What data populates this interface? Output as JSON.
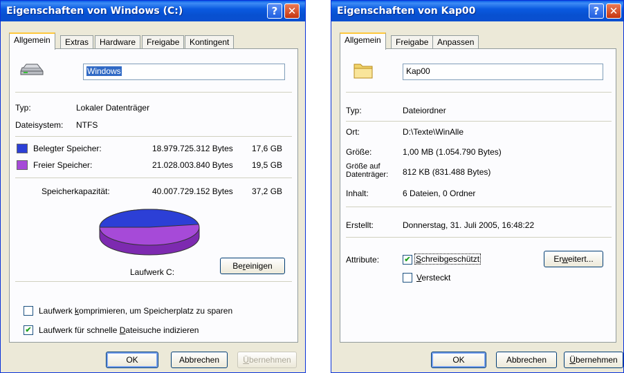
{
  "colors": {
    "used": "#2c3fd6",
    "free": "#a64ad8",
    "titlebar": "#0a5ae0"
  },
  "window1": {
    "title": "Eigenschaften von Windows (C:)",
    "tabs": [
      "Allgemein",
      "Extras",
      "Hardware",
      "Freigabe",
      "Kontingent"
    ],
    "drive_icon": "drive-icon",
    "name_value": "Windows",
    "type_label": "Typ:",
    "type_value": "Lokaler Datenträger",
    "fs_label": "Dateisystem:",
    "fs_value": "NTFS",
    "used_label": "Belegter Speicher:",
    "used_bytes": "18.979.725.312 Bytes",
    "used_gb": "17,6 GB",
    "free_label": "Freier Speicher:",
    "free_bytes": "21.028.003.840 Bytes",
    "free_gb": "19,5 GB",
    "capacity_label": "Speicherkapazität:",
    "capacity_bytes": "40.007.729.152 Bytes",
    "capacity_gb": "37,2 GB",
    "pie_used_fraction": 0.4744,
    "drive_caption": "Laufwerk C:",
    "cleanup_button": {
      "pre": "Be",
      "key": "r",
      "post": "einigen"
    },
    "compress": {
      "pre": "Laufwerk ",
      "key": "k",
      "post": "omprimieren, um Speicherplatz zu sparen",
      "checked": false
    },
    "index": {
      "pre": "Laufwerk für schnelle ",
      "key": "D",
      "post": "ateisuche indizieren",
      "checked": true
    },
    "ok": "OK",
    "cancel": "Abbrechen",
    "apply": {
      "key": "Ü",
      "post": "bernehmen"
    }
  },
  "window2": {
    "title": "Eigenschaften von Kap00",
    "tabs": [
      "Allgemein",
      "Freigabe",
      "Anpassen"
    ],
    "folder_icon": "folder-icon",
    "name_value": "Kap00",
    "type_label": "Typ:",
    "type_value": "Dateiordner",
    "location_label": "Ort:",
    "location_value": "D:\\Texte\\WinAlle",
    "size_label": "Größe:",
    "size_value": "1,00 MB (1.054.790 Bytes)",
    "disk_size_label_1": "Größe auf",
    "disk_size_label_2": "Datenträger:",
    "disk_size_value": "812 KB (831.488 Bytes)",
    "contents_label": "Inhalt:",
    "contents_value": "6 Dateien, 0 Ordner",
    "created_label": "Erstellt:",
    "created_value": "Donnerstag, 31. Juli 2005, 16:48:22",
    "attributes_label": "Attribute:",
    "readonly": {
      "key": "S",
      "post": "chreibgeschützt",
      "checked": true
    },
    "hidden": {
      "key": "V",
      "post": "ersteckt",
      "checked": false
    },
    "advanced_button": {
      "pre": "Er",
      "key": "w",
      "post": "eitert..."
    },
    "ok": "OK",
    "cancel": "Abbrechen",
    "apply": {
      "key": "Ü",
      "post": "bernehmen"
    }
  }
}
